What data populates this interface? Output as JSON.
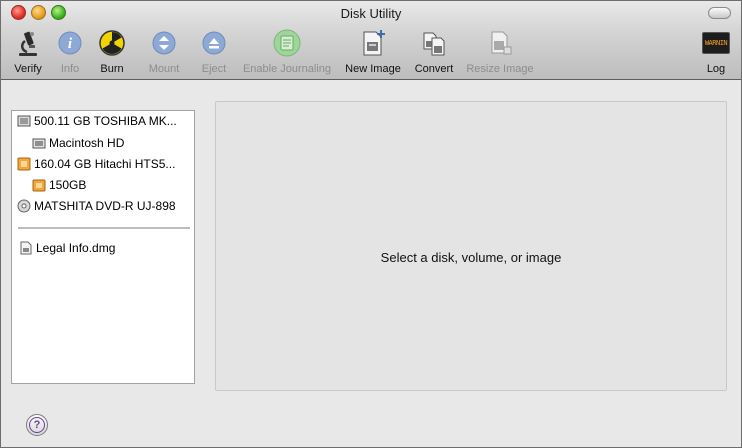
{
  "window": {
    "title": "Disk Utility"
  },
  "toolbar": {
    "verify": "Verify",
    "info": "Info",
    "burn": "Burn",
    "mount": "Mount",
    "eject": "Eject",
    "enable_journaling": "Enable Journaling",
    "new_image": "New Image",
    "convert": "Convert",
    "resize_image": "Resize Image",
    "log": "Log",
    "log_icon_text": "WARNIN"
  },
  "sidebar": {
    "items": [
      {
        "label": "500.11 GB TOSHIBA MK...",
        "icon": "internal-disk-icon"
      },
      {
        "label": "Macintosh HD",
        "icon": "volume-icon"
      },
      {
        "label": "160.04 GB Hitachi HTS5...",
        "icon": "external-disk-icon"
      },
      {
        "label": "150GB",
        "icon": "external-volume-icon"
      },
      {
        "label": "MATSHITA DVD-R UJ-898",
        "icon": "optical-drive-icon"
      }
    ],
    "images": [
      {
        "label": "Legal Info.dmg",
        "icon": "disk-image-icon"
      }
    ]
  },
  "main": {
    "placeholder": "Select a disk, volume, or image"
  },
  "help": {
    "label": "?"
  }
}
